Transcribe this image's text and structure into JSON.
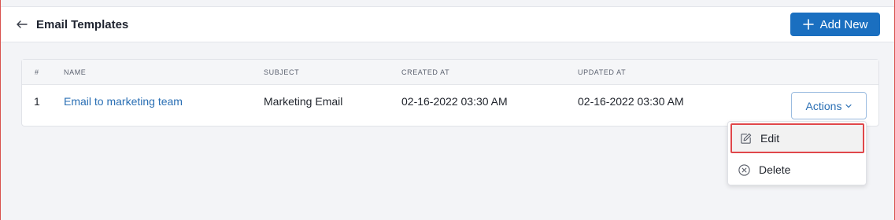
{
  "header": {
    "title": "Email Templates",
    "add_button_label": "Add New"
  },
  "table": {
    "columns": [
      "#",
      "NAME",
      "SUBJECT",
      "CREATED AT",
      "UPDATED AT"
    ],
    "rows": [
      {
        "index": "1",
        "name": "Email to marketing team",
        "subject": "Marketing Email",
        "created_at": "02-16-2022 03:30 AM",
        "updated_at": "02-16-2022 03:30 AM",
        "actions_label": "Actions"
      }
    ]
  },
  "actions_menu": {
    "items": [
      {
        "label": "Edit",
        "icon": "edit-icon",
        "highlighted": true
      },
      {
        "label": "Delete",
        "icon": "delete-circle-x-icon",
        "highlighted": false
      }
    ]
  },
  "colors": {
    "primary": "#1a6fc0",
    "link": "#2a6fb4",
    "highlight_border": "#e0474a"
  }
}
